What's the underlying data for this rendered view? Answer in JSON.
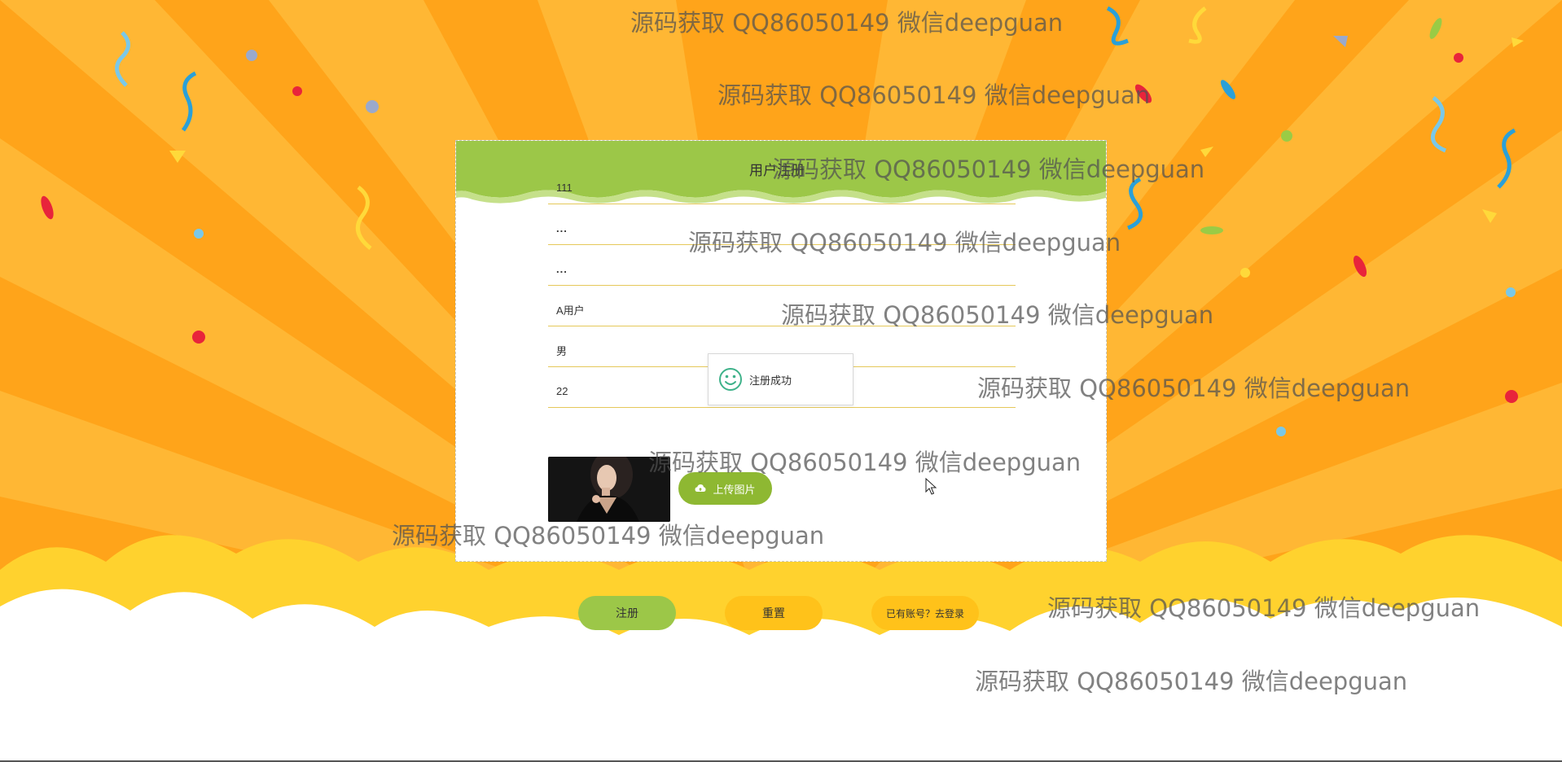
{
  "form": {
    "title": "用户注册",
    "fields": [
      {
        "name": "username",
        "value": "111"
      },
      {
        "name": "password",
        "value": "..."
      },
      {
        "name": "confirm-password",
        "value": "..."
      },
      {
        "name": "nickname",
        "value": "A用户"
      },
      {
        "name": "gender",
        "value": "男"
      },
      {
        "name": "age",
        "value": "22"
      }
    ],
    "upload_label": "上传图片"
  },
  "toast": {
    "message": "注册成功",
    "icon": "smile-icon"
  },
  "buttons": {
    "register": "注册",
    "reset": "重置",
    "login": "已有账号？去登录"
  },
  "watermarks": [
    "源码获取 QQ86050149 微信deepguan",
    "源码获取 QQ86050149 微信deepguan",
    "源码获取 QQ86050149 微信deepguan",
    "源码获取 QQ86050149 微信deepguan",
    "源码获取 QQ86050149 微信deepguan",
    "源码获取 QQ86050149 微信deepguan",
    "源码获取 QQ86050149 微信deepguan",
    "源码获取 QQ86050149 微信deepguan",
    "源码获取 QQ86050149 微信deepguan",
    "源码获取 QQ86050149 微信deepguan"
  ],
  "colors": {
    "background": "#ffa41a",
    "rays": "#ffbe3d",
    "header_green": "#9cc748",
    "field_underline": "#e5c85a",
    "upload_button": "#8eb832",
    "register_button": "#9cc748",
    "reset_button": "#ffc21a",
    "clouds": "#ffd22e"
  }
}
